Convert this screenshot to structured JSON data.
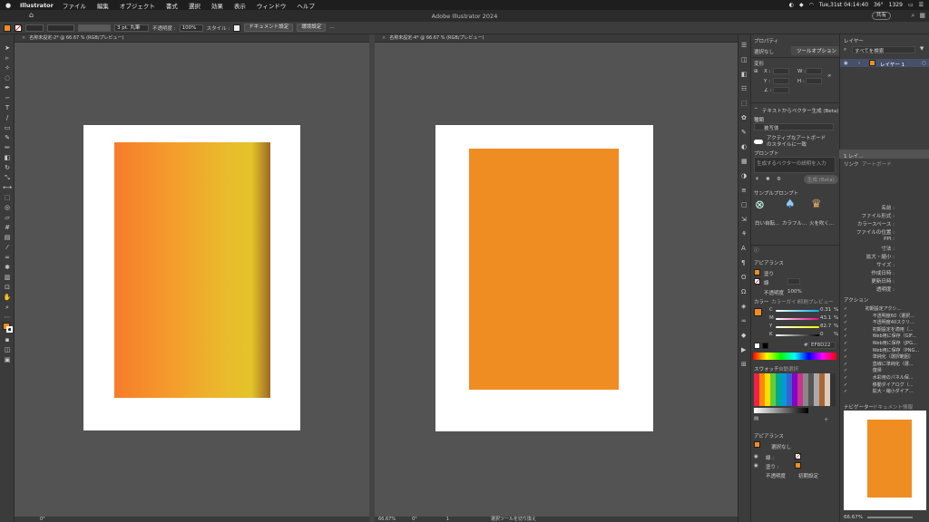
{
  "menubar": {
    "apple": "",
    "app": "Illustrator",
    "items": [
      "ファイル",
      "編集",
      "オブジェクト",
      "書式",
      "選択",
      "効果",
      "表示",
      "ウィンドウ",
      "ヘルプ"
    ],
    "datetime": "Tue,31st 04:14:40",
    "temp": "36°",
    "mem": "1329"
  },
  "appbar": {
    "title": "Adobe Illustrator 2024",
    "share": "共有"
  },
  "control": {
    "stroke_weight": "3 pt. 丸筆",
    "opacity_label": "不透明度 :",
    "opacity": "100%",
    "style_label": "スタイル :",
    "doc_setup": "ドキュメント設定",
    "prefs": "環境設定"
  },
  "docs": {
    "left_tab": "名称未設定-2* @ 66.67 % (RGB/プレビュー)",
    "right_tab": "名称未設定-4* @ 66.67 % (RGB/プレビュー)",
    "left_angle": "0°",
    "right_zoom": "66.67%",
    "right_angle": "0°",
    "right_artboard": "1",
    "right_status": "選択ツールを切り換え"
  },
  "colors": {
    "orange_flat": "#EF8D22",
    "gradient_start": "#F67C2A",
    "gradient_mid": "#E8B52C",
    "gradient_end": "#9E6A24",
    "fill": "#EF8D22"
  },
  "properties": {
    "tab1": "プロパティ",
    "tab2": "ツールオプション",
    "no_selection": "選択なし",
    "transform": "変形",
    "x": "X :",
    "y": "Y :",
    "w": "W :",
    "h": "H :",
    "angle": "∠ :",
    "gen_title": "テキストからベクター生成 (Beta)",
    "kind": "種類",
    "kind_value": "被写体",
    "active_label": "アクティブなアートボードのスタイルに一致",
    "prompt": "プロンプト",
    "prompt_placeholder": "生成するベクターの説明を入力",
    "generate": "生成 (Beta)",
    "sample_prompts": "サンプルプロンプト",
    "samples": [
      "白い自転...",
      "カラフル...",
      "火を吹く..."
    ],
    "appearance": "アピアランス",
    "fill_label": "塗り",
    "stroke_label": "線",
    "opacity_label": "不透明度",
    "opacity_value": "100%"
  },
  "layers": {
    "title": "レイヤー",
    "search": "すべてを検索",
    "layer1": "レイヤー 1",
    "count": "1 レイ...",
    "links_tab": "リンク",
    "artboards_tab": "アートボード",
    "info_rows": [
      "名前 :",
      "ファイル形式 :",
      "カラースペース :",
      "ファイルの位置 :",
      "PPI :",
      "寸法 :",
      "拡大・縮小 :",
      "サイズ :",
      "作成日時 :",
      "更新日時 :",
      "透明度 :"
    ]
  },
  "color_panel": {
    "tabs": [
      "カラー",
      "カラーガイド",
      "印刷プレビュー"
    ],
    "c": "0.31",
    "m": "43.1",
    "y": "82.7",
    "k": "0",
    "hex": "EF8D22",
    "pct": "%"
  },
  "swatches": {
    "tab1": "スウォッチ",
    "tab2": "自動選択"
  },
  "appearance_bottom": {
    "title": "アピアランス",
    "no_sel": "選択なし",
    "stroke": "線 :",
    "fill": "塗り :",
    "opacity": "不透明度",
    "opacity_val": "初期設定"
  },
  "actions": {
    "title": "アクション",
    "items": [
      "初期設定アクシ...",
      "不透明度60（選択...",
      "不透明度40スクリ...",
      "初期設定を適用（...",
      "Web用に保存（GIF...",
      "Web用に保存（JPG...",
      "Web用に保存（PNG...",
      "単純化（選択範囲）",
      "直線に単純化（選...",
      "復帰",
      "水彩用のパネル保...",
      "移動ダイアログ（...",
      "拡大・縮小ダイア..."
    ]
  },
  "navigator": {
    "tab1": "ナビゲーター",
    "tab2": "ドキュメント情報",
    "zoom": "66.67%"
  }
}
